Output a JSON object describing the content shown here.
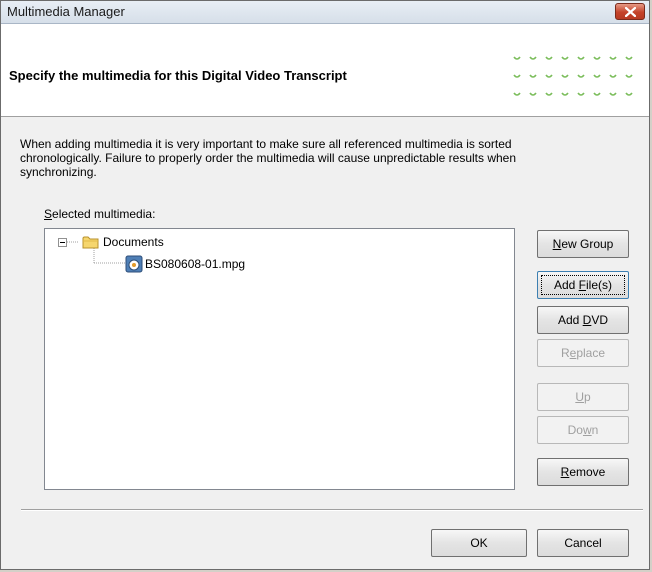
{
  "window": {
    "title": "Multimedia Manager"
  },
  "header": {
    "heading": "Specify the multimedia for this Digital Video Transcript",
    "dot_color": "#7bbd5b"
  },
  "intro": {
    "line1": "When adding multimedia it is very important to make sure all referenced multimedia is sorted",
    "line2": "chronologically.  Failure to properly order the multimedia will cause unpredictable results when",
    "line3": "synchronizing."
  },
  "selected_label": {
    "mnemonic": "S",
    "rest": "elected multimedia:"
  },
  "tree": {
    "folder": {
      "label": "Documents",
      "expanded": true,
      "children": [
        {
          "label": "BS080608-01.mpg",
          "icon": "media-file-icon"
        }
      ]
    }
  },
  "buttons": {
    "new_group": {
      "mnemonic": "N",
      "rest": "ew Group",
      "enabled": true
    },
    "add_files": {
      "pre": "Add ",
      "mnemonic": "F",
      "rest": "ile(s)",
      "enabled": true,
      "focused": true
    },
    "add_dvd": {
      "pre": "Add ",
      "mnemonic": "D",
      "rest": "VD",
      "enabled": true
    },
    "replace": {
      "pre": "R",
      "mnemonic": "e",
      "rest": "place",
      "enabled": false
    },
    "up": {
      "mnemonic": "U",
      "rest": "p",
      "enabled": false
    },
    "down": {
      "pre": "Do",
      "mnemonic": "w",
      "rest": "n",
      "enabled": false
    },
    "remove": {
      "mnemonic": "R",
      "rest": "emove",
      "enabled": true
    }
  },
  "footer": {
    "ok_label": "OK",
    "cancel_label": "Cancel"
  }
}
